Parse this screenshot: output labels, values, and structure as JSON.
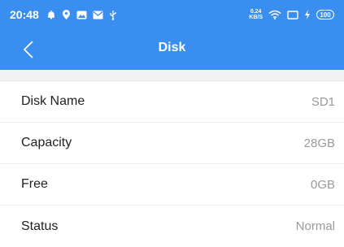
{
  "status_bar": {
    "time": "20:48",
    "speed_value": "0.24",
    "speed_unit": "KB/S",
    "battery": "100",
    "icons": [
      "notification-icon",
      "location-icon",
      "gallery-icon",
      "mail-icon",
      "usb-icon",
      "wifi-icon",
      "screen-icon",
      "charging-icon",
      "battery-icon"
    ]
  },
  "nav": {
    "title": "Disk",
    "back_icon": "chevron-left-icon"
  },
  "disk_info": [
    {
      "label": "Disk Name",
      "value": "SD1"
    },
    {
      "label": "Capacity",
      "value": "28GB"
    },
    {
      "label": "Free",
      "value": "0GB"
    },
    {
      "label": "Status",
      "value": "Normal"
    }
  ],
  "colors": {
    "accent": "#3a8eef",
    "background": "#f2f2f2",
    "value_text": "#9a9a9a"
  }
}
